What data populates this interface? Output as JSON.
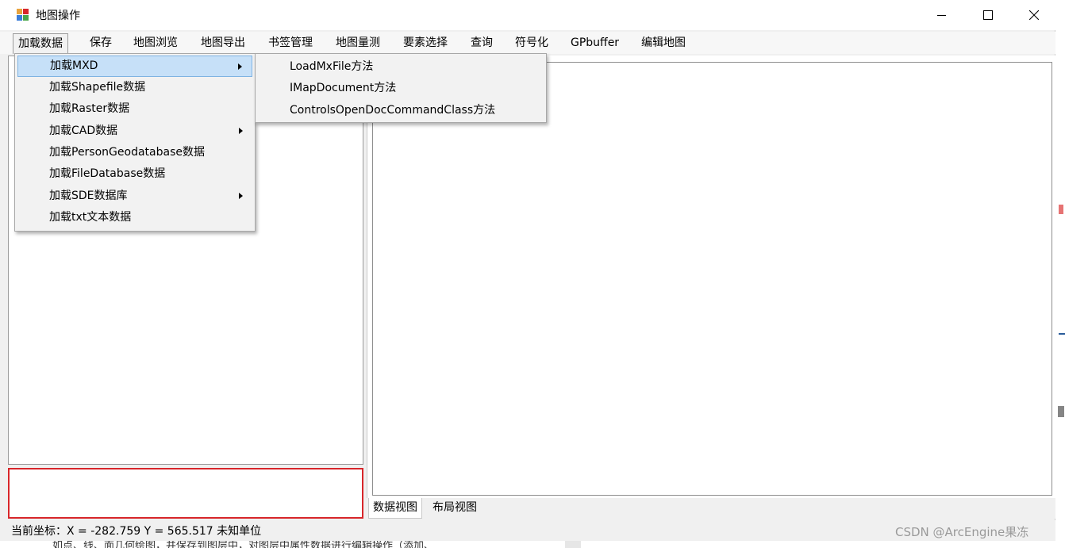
{
  "window": {
    "title": "地图操作",
    "controls": {
      "minimize_icon": "minimize-icon",
      "maximize_icon": "maximize-icon",
      "close_icon": "close-icon"
    }
  },
  "menubar": {
    "items": [
      {
        "label": "加载数据"
      },
      {
        "label": "保存"
      },
      {
        "label": "地图浏览"
      },
      {
        "label": "地图导出"
      },
      {
        "label": "书签管理"
      },
      {
        "label": "地图量测"
      },
      {
        "label": "要素选择"
      },
      {
        "label": "查询"
      },
      {
        "label": "符号化"
      },
      {
        "label": "GPbuffer"
      },
      {
        "label": "编辑地图"
      }
    ],
    "open_item": "加载数据"
  },
  "dropdown": {
    "items": [
      {
        "label": "加载MXD",
        "has_submenu": true,
        "highlighted": true
      },
      {
        "label": "加载Shapefile数据"
      },
      {
        "label": "加载Raster数据"
      },
      {
        "label": "加载CAD数据",
        "has_submenu": true
      },
      {
        "label": "加载PersonGeodatabase数据"
      },
      {
        "label": "加载FileDatabase数据"
      },
      {
        "label": "加载SDE数据库",
        "has_submenu": true
      },
      {
        "label": "加载txt文本数据"
      }
    ]
  },
  "submenu": {
    "items": [
      {
        "label": "LoadMxFile方法"
      },
      {
        "label": "IMapDocument方法"
      },
      {
        "label": "ControlsOpenDocCommandClass方法"
      }
    ]
  },
  "tabs": [
    {
      "label": "数据视图",
      "active": true
    },
    {
      "label": "布局视图",
      "active": false
    }
  ],
  "status": {
    "text": "当前坐标：X = -282.759 Y = 565.517 未知单位"
  },
  "background": {
    "bottom_text": "如点、线、面几何绘图，并保存到图层中，对图层中属性数据进行编辑操作（添加、"
  },
  "watermark": "CSDN @ArcEngine果冻",
  "colors": {
    "highlight_bg": "#c6e0f8",
    "highlight_border": "#7fb3e2",
    "accent_red": "#d8262a"
  }
}
